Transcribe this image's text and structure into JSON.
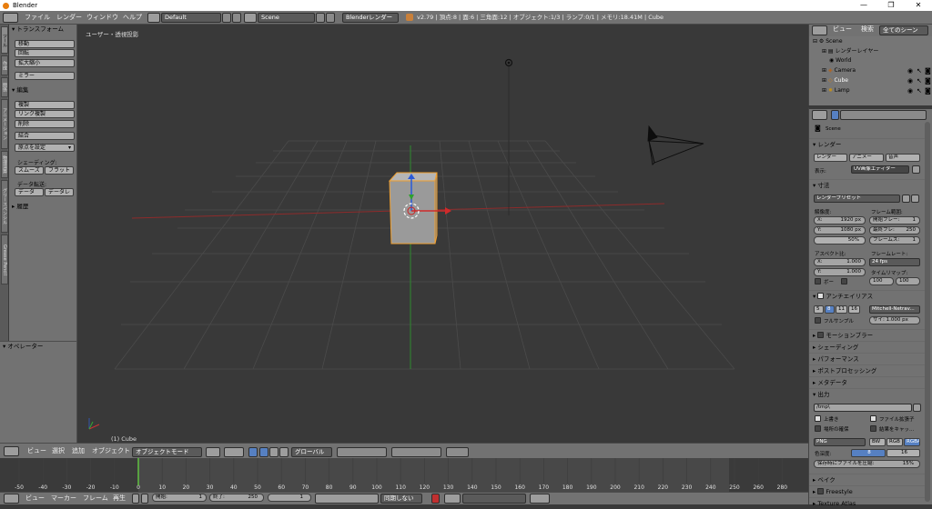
{
  "window": {
    "title": "Blender",
    "controls": [
      "—",
      "❐",
      "✕"
    ]
  },
  "info": {
    "menus": [
      "ファイル",
      "レンダー",
      "ウィンドウ",
      "ヘルプ"
    ],
    "screen_layout": "Default",
    "scene": "Scene",
    "engine": "Blenderレンダー",
    "stats": "v2.79 | 頂点:8 | 面:6 | 三角面:12 | オブジェクト:1/3 | ランプ:0/1 | メモリ:18.41M | Cube"
  },
  "tabs": [
    "ツール",
    "作成",
    "関係",
    "アニメーション",
    "物理演算",
    "グリースペンシル",
    "Grease Pencil"
  ],
  "toolshelf": {
    "transform_header": "トランスフォーム",
    "transform_buttons": [
      "移動",
      "回転",
      "拡大縮小"
    ],
    "mirror_button": "ミラー",
    "edit_header": "編集",
    "edit_buttons": [
      "複製",
      "リンク複製",
      "削除"
    ],
    "join_button": "結合",
    "origin_button": "原点を設定",
    "shading_label": "シェーディング:",
    "smooth_button": "スムーズ",
    "flat_button": "フラット",
    "data_transfer_label": "データ転送:",
    "data_button": "データ",
    "data_layer_button": "データレ",
    "history_header": "履歴"
  },
  "operator": {
    "header": "オペレーター"
  },
  "viewport": {
    "view_label": "ユーザー・透視投影",
    "object_label": "(1) Cube"
  },
  "view3d_header": {
    "menus": [
      "ビュー",
      "選択",
      "追加",
      "オブジェクト"
    ],
    "mode": "オブジェクトモード",
    "orientation": "グローバル"
  },
  "timeline": {
    "ticks": [
      "-50",
      "-40",
      "-30",
      "-20",
      "-10",
      "0",
      "10",
      "20",
      "30",
      "40",
      "50",
      "60",
      "70",
      "80",
      "90",
      "100",
      "110",
      "120",
      "130",
      "140",
      "150",
      "160",
      "170",
      "180",
      "190",
      "200",
      "210",
      "220",
      "230",
      "240",
      "250",
      "260",
      "280"
    ],
    "current_frame_marker": 0,
    "menus": [
      "ビュー",
      "マーカー",
      "フレーム",
      "再生"
    ],
    "start_label": "開始:",
    "start_value": "1",
    "end_label": "終了:",
    "end_value": "250",
    "current_value": "1",
    "sync": "同期しない"
  },
  "outliner": {
    "view": "ビュー",
    "search": "検索",
    "filter": "全てのシーン",
    "items": [
      "Scene",
      "レンダーレイヤー",
      "World",
      "Camera",
      "Cube",
      "Lamp"
    ]
  },
  "properties": {
    "scene_name": "Scene",
    "render_header": "レンダー",
    "render_btn": "レンダー",
    "anim_btn": "アニメー",
    "audio_btn": "音声",
    "display_label": "表示:",
    "display_value": "UV画像エディター",
    "dimensions_header": "寸法",
    "render_presets": "レンダープリセット",
    "resolution_label": "解像度:",
    "res_x": "X:",
    "res_x_val": "1920 px",
    "res_y": "Y:",
    "res_y_val": "1080 px",
    "res_pct": "50%",
    "frame_range_label": "フレーム範囲:",
    "start_frame": "開始フレー:",
    "start_frame_val": "1",
    "end_frame": "最終フレ:",
    "end_frame_val": "250",
    "frame_step": "フレームス:",
    "frame_step_val": "1",
    "aspect_label": "アスペクト比:",
    "asp_x": "X:",
    "asp_x_val": "1.000",
    "asp_y": "Y:",
    "asp_y_val": "1.000",
    "fps_label": "フレームレート:",
    "fps_value": "24 fps",
    "timeremap_label": "タイムリマップ:",
    "remap_old": "100",
    "remap_new": "100",
    "border_label": "ボー",
    "aa_header": "アンチエイリアス",
    "aa_samples": [
      "5",
      "8",
      "11",
      "16"
    ],
    "aa_filter": "Mitchell-Netrav...",
    "full_sample": "フルサンプル",
    "aa_size": "サイ: 1.000 px",
    "sections": [
      "モーションブラー",
      "シェーディング",
      "パフォーマンス",
      "ポストプロセッシング",
      "メタデータ"
    ],
    "output_header": "出力",
    "output_path": "/tmp\\",
    "overwrite": "上書き",
    "file_ext": "ファイル拡張子",
    "placeholders": "場所の確保",
    "cache": "結果をキャッ...",
    "format": "PNG",
    "bw": "BW",
    "rgb": "RGB",
    "rgba": "RGBA",
    "color_depth_label": "色深度:",
    "depth_8": "8",
    "depth_16": "16",
    "compression_label": "保存時にファイルを圧縮:",
    "compression_val": "15%",
    "bake_header": "ベイク",
    "freestyle": "Freestyle",
    "texture_atlas": "Texture Atlas"
  },
  "colors": {
    "accent_blue": "#5680c2",
    "selected_orange": "#f0a030",
    "grid": "#4a4a4a",
    "x_axis": "#a33030",
    "y_axis": "#3a9a3a"
  }
}
